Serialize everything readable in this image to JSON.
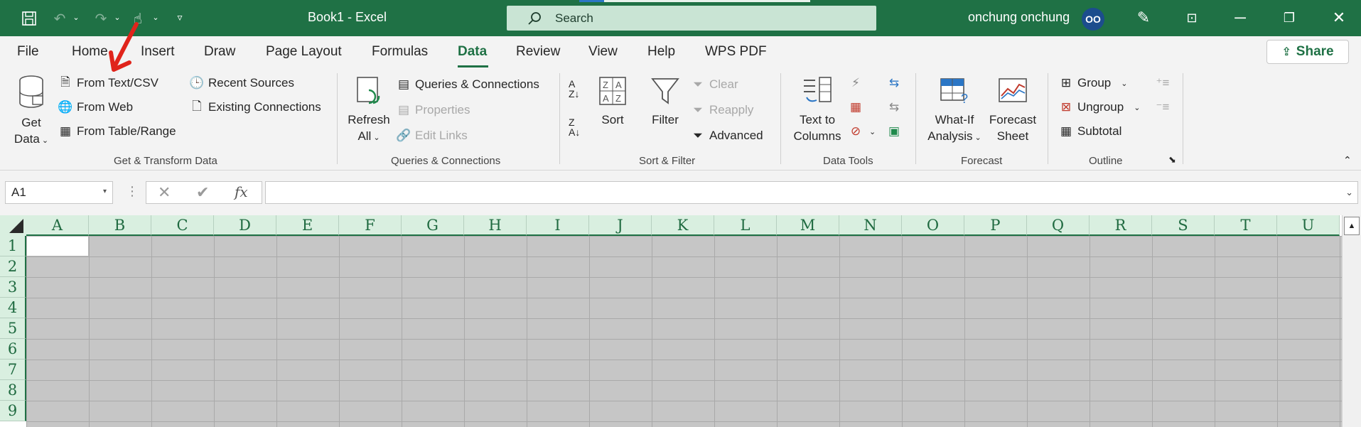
{
  "titlebar": {
    "doc_title": "Book1  -  Excel",
    "search_placeholder": "Search",
    "user_name": "onchung onchung",
    "avatar_initials": "OO",
    "icons": [
      "save-icon",
      "undo-icon",
      "redo-icon",
      "touch-mode-icon",
      "customize-icon",
      "pen-icon",
      "ribbon-display-icon",
      "minimize-icon",
      "restore-icon",
      "close-icon"
    ]
  },
  "tabs": [
    "File",
    "Home",
    "Insert",
    "Draw",
    "Page Layout",
    "Formulas",
    "Data",
    "Review",
    "View",
    "Help",
    "WPS PDF"
  ],
  "active_tab": "Data",
  "share_label": "Share",
  "ribbon": {
    "get_transform": {
      "get_data": [
        "Get",
        "Data"
      ],
      "from_text_csv": "From Text/CSV",
      "from_web": "From Web",
      "from_table_range": "From Table/Range",
      "recent_sources": "Recent Sources",
      "existing_connections": "Existing Connections",
      "label": "Get & Transform Data"
    },
    "queries": {
      "refresh_all": [
        "Refresh",
        "All"
      ],
      "queries_connections": "Queries & Connections",
      "properties": "Properties",
      "edit_links": "Edit Links",
      "label": "Queries & Connections"
    },
    "sort_filter": {
      "sort": "Sort",
      "filter": "Filter",
      "clear": "Clear",
      "reapply": "Reapply",
      "advanced": "Advanced",
      "label": "Sort & Filter"
    },
    "data_tools": {
      "text_to_columns": [
        "Text to",
        "Columns"
      ],
      "label": "Data Tools"
    },
    "forecast": {
      "what_if": [
        "What-If",
        "Analysis"
      ],
      "forecast_sheet": [
        "Forecast",
        "Sheet"
      ],
      "label": "Forecast"
    },
    "outline": {
      "group": "Group",
      "ungroup": "Ungroup",
      "subtotal": "Subtotal",
      "label": "Outline"
    }
  },
  "formula_bar": {
    "name_box": "A1",
    "cancel": "✕",
    "enter": "✔",
    "fx": "fx",
    "formula": ""
  },
  "sheet": {
    "columns": [
      "A",
      "B",
      "C",
      "D",
      "E",
      "F",
      "G",
      "H",
      "I",
      "J",
      "K",
      "L",
      "M",
      "N",
      "O",
      "P",
      "Q",
      "R",
      "S",
      "T",
      "U"
    ],
    "rows": [
      "1",
      "2",
      "3",
      "4",
      "5",
      "6",
      "7",
      "8",
      "9"
    ],
    "selected_cell": "A1"
  },
  "colors": {
    "accent": "#1f7145",
    "header_bg": "#d9efe0",
    "selection_fill": "#c6c6c6",
    "annotation_arrow": "#e0241b"
  }
}
